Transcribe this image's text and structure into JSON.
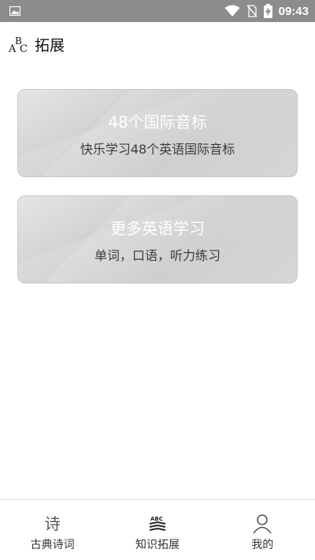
{
  "status_bar": {
    "time": "09:43",
    "icons": [
      "gallery-icon",
      "wifi-icon",
      "no-sim-icon",
      "battery-charging-icon"
    ]
  },
  "header": {
    "logo_icon": "abc-icon",
    "title": "拓展"
  },
  "cards": [
    {
      "title": "48个国际音标",
      "subtitle": "快乐学习48个英语国际音标"
    },
    {
      "title": "更多英语学习",
      "subtitle": "单词，口语，听力练习"
    }
  ],
  "bottom_nav": {
    "items": [
      {
        "label": "古典诗词",
        "icon": "poem-icon",
        "glyph": "诗"
      },
      {
        "label": "知识拓展",
        "icon": "abc-books-icon"
      },
      {
        "label": "我的",
        "icon": "person-icon"
      }
    ]
  },
  "colors": {
    "status_bar": "#8c8c8c",
    "card_bg": "#d6d6d6",
    "card_title": "#ffffff",
    "card_subtitle": "#3c3c3c"
  }
}
